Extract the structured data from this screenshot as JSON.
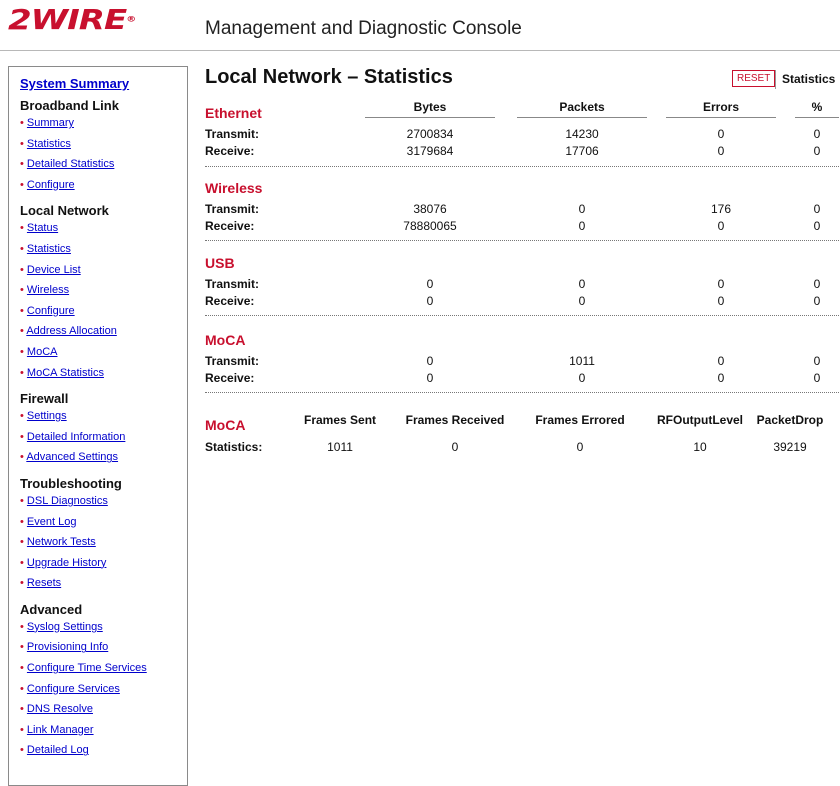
{
  "header": {
    "logo_text": "2WIRE",
    "logo_mark": "®",
    "title": "Management and Diagnostic Console"
  },
  "sidebar": {
    "system_summary": "System Summary",
    "sections": [
      {
        "title": "Broadband Link",
        "items": [
          "Summary",
          "Statistics",
          "Detailed Statistics",
          "Configure"
        ]
      },
      {
        "title": "Local Network",
        "items": [
          "Status",
          "Statistics",
          "Device List",
          "Wireless",
          "Configure",
          "Address Allocation",
          "MoCA",
          "MoCA Statistics"
        ]
      },
      {
        "title": "Firewall",
        "items": [
          "Settings",
          "Detailed Information",
          "Advanced Settings"
        ]
      },
      {
        "title": "Troubleshooting",
        "items": [
          "DSL Diagnostics",
          "Event Log",
          "Network Tests",
          "Upgrade History",
          "Resets"
        ]
      },
      {
        "title": "Advanced",
        "items": [
          "Syslog Settings",
          "Provisioning Info",
          "Configure Time Services",
          "Configure Services",
          "DNS Resolve",
          "Link Manager",
          "Detailed Log"
        ]
      }
    ],
    "bullet": "•"
  },
  "main": {
    "title": "Local Network – Statistics",
    "reset_label": "RESET",
    "tab_label": "Statistics",
    "columns": [
      "Bytes",
      "Packets",
      "Errors",
      "%"
    ],
    "row_labels": {
      "transmit": "Transmit:",
      "receive": "Receive:"
    },
    "sections": [
      {
        "name": "Ethernet",
        "transmit": [
          "2700834",
          "14230",
          "0",
          "0"
        ],
        "receive": [
          "3179684",
          "17706",
          "0",
          "0"
        ]
      },
      {
        "name": "Wireless",
        "transmit": [
          "38076",
          "0",
          "176",
          "0"
        ],
        "receive": [
          "78880065",
          "0",
          "0",
          "0"
        ]
      },
      {
        "name": "USB",
        "transmit": [
          "0",
          "0",
          "0",
          "0"
        ],
        "receive": [
          "0",
          "0",
          "0",
          "0"
        ]
      },
      {
        "name": "MoCA",
        "transmit": [
          "0",
          "1011",
          "0",
          "0"
        ],
        "receive": [
          "0",
          "0",
          "0",
          "0"
        ]
      }
    ],
    "moca_stats": {
      "name": "MoCA",
      "row_label": "Statistics:",
      "headers": [
        "Frames Sent",
        "Frames Received",
        "Frames Errored",
        "RFOutputLevel",
        "PacketDrop"
      ],
      "values": [
        "1011",
        "0",
        "0",
        "10",
        "39219"
      ]
    }
  }
}
